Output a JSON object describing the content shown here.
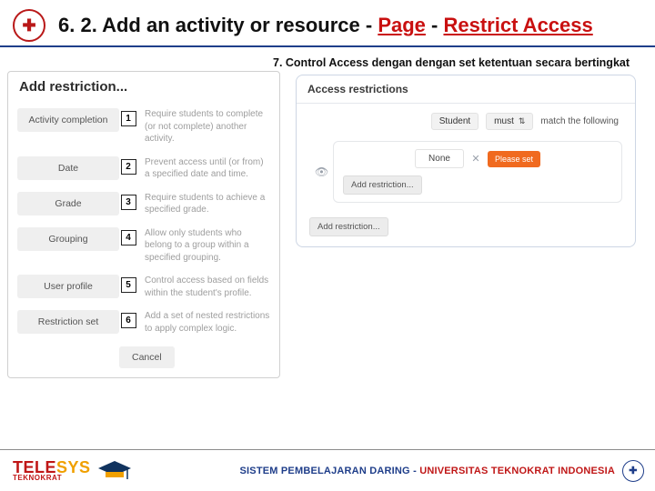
{
  "header": {
    "title_prefix": "6. 2. Add an activity or resource - ",
    "em1": "Page",
    "sep": " - ",
    "em2": "Restrict Access"
  },
  "subtitle": "7. Control Access dengan dengan set ketentuan secara bertingkat",
  "modal": {
    "title": "Add restriction...",
    "options": [
      {
        "pill": "Activity completion",
        "num": "1",
        "desc": "Require students to complete (or not complete) another activity."
      },
      {
        "pill": "Date",
        "num": "2",
        "desc": "Prevent access until (or from) a specified date and time."
      },
      {
        "pill": "Grade",
        "num": "3",
        "desc": "Require students to achieve a specified grade."
      },
      {
        "pill": "Grouping",
        "num": "4",
        "desc": "Allow only students who belong to a group within a specified grouping."
      },
      {
        "pill": "User profile",
        "num": "5",
        "desc": "Control access based on fields within the student's profile."
      },
      {
        "pill": "Restriction set",
        "num": "6",
        "desc": "Add a set of nested restrictions to apply complex logic."
      }
    ],
    "cancel": "Cancel"
  },
  "panel": {
    "title": "Access restrictions",
    "dropdown1": "Student",
    "dropdown2": "must",
    "match": "match the following",
    "none": "None",
    "please": "Please set",
    "add_inner": "Add restriction...",
    "add_outer": "Add restriction..."
  },
  "footer": {
    "brand1a": "TELE",
    "brand1b": "SYS",
    "brand2": "TEKNOKRAT",
    "text_a": "SISTEM PEMBELAJARAN DARING - ",
    "text_b": "UNIVERSITAS TEKNOKRAT INDONESIA"
  }
}
